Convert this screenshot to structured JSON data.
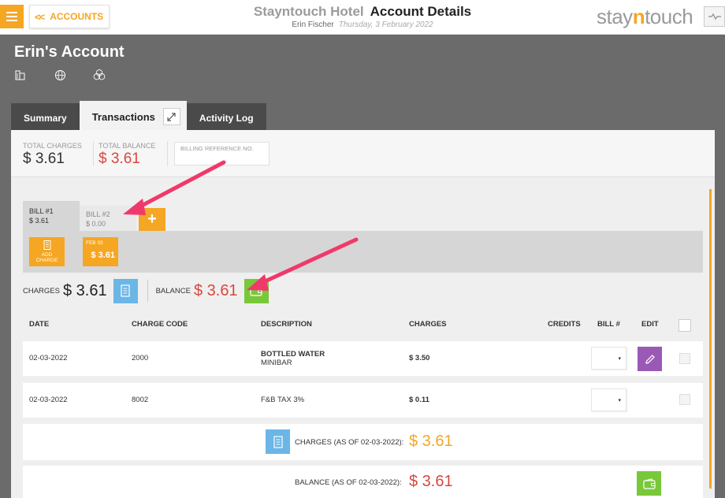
{
  "header": {
    "back_label": "ACCOUNTS",
    "hotel_name": "Stayntouch Hotel",
    "page_title": "Account Details",
    "user_name": "Erin Fischer",
    "date": "Thursday, 3 February 2022",
    "logo_pre": "stay",
    "logo_n": "n",
    "logo_post": "touch"
  },
  "account": {
    "name": "Erin's Account",
    "icons": [
      "building-icon",
      "globe-icon",
      "circles-icon"
    ]
  },
  "tabs": [
    {
      "label": "Summary"
    },
    {
      "label": "Transactions"
    },
    {
      "label": "Activity Log"
    }
  ],
  "summary": {
    "total_charges_label": "TOTAL CHARGES",
    "total_charges": "$ 3.61",
    "total_balance_label": "TOTAL BALANCE",
    "total_balance": "$ 3.61",
    "billing_ref_label": "BILLING REFERENCE NO."
  },
  "bills": [
    {
      "name": "BILL #1",
      "amount": "$ 3.61"
    },
    {
      "name": "BILL #2",
      "amount": "$ 0.00"
    }
  ],
  "add_bill_label": "+",
  "add_charge_label": [
    "ADD",
    "CHARGE"
  ],
  "date_card": {
    "date": "FEB 03",
    "amount": "$ 3.61"
  },
  "charges_label": "CHARGES",
  "charges_value": "$ 3.61",
  "balance_label": "BALANCE",
  "balance_value": "$ 3.61",
  "table": {
    "headers": {
      "date": "DATE",
      "charge_code": "CHARGE CODE",
      "description": "DESCRIPTION",
      "charges": "CHARGES",
      "credits": "CREDITS",
      "bill": "BILL #",
      "edit": "EDIT"
    },
    "rows": [
      {
        "date": "02-03-2022",
        "code": "2000",
        "desc": "BOTTLED WATER",
        "desc_sub": "MINIBAR",
        "charges": "$ 3.50",
        "credits": "",
        "bill_dd": "▾"
      },
      {
        "date": "02-03-2022",
        "code": "8002",
        "desc": "F&B TAX 3%",
        "desc_sub": "",
        "charges": "$ 0.11",
        "credits": "",
        "bill_dd": "▾"
      }
    ]
  },
  "totals": {
    "charges_label": "CHARGES (AS OF 02-03-2022):",
    "charges_value": "$ 3.61",
    "balance_label": "BALANCE (AS OF 02-03-2022):",
    "balance_value": "$ 3.61"
  },
  "colors": {
    "accent": "#f5a623",
    "balance_red": "#d9473d",
    "edit_purple": "#9b59b6",
    "pay_green": "#78c83a",
    "invoice_blue": "#6bb6e6",
    "annotation_arrow": "#f0396b"
  }
}
